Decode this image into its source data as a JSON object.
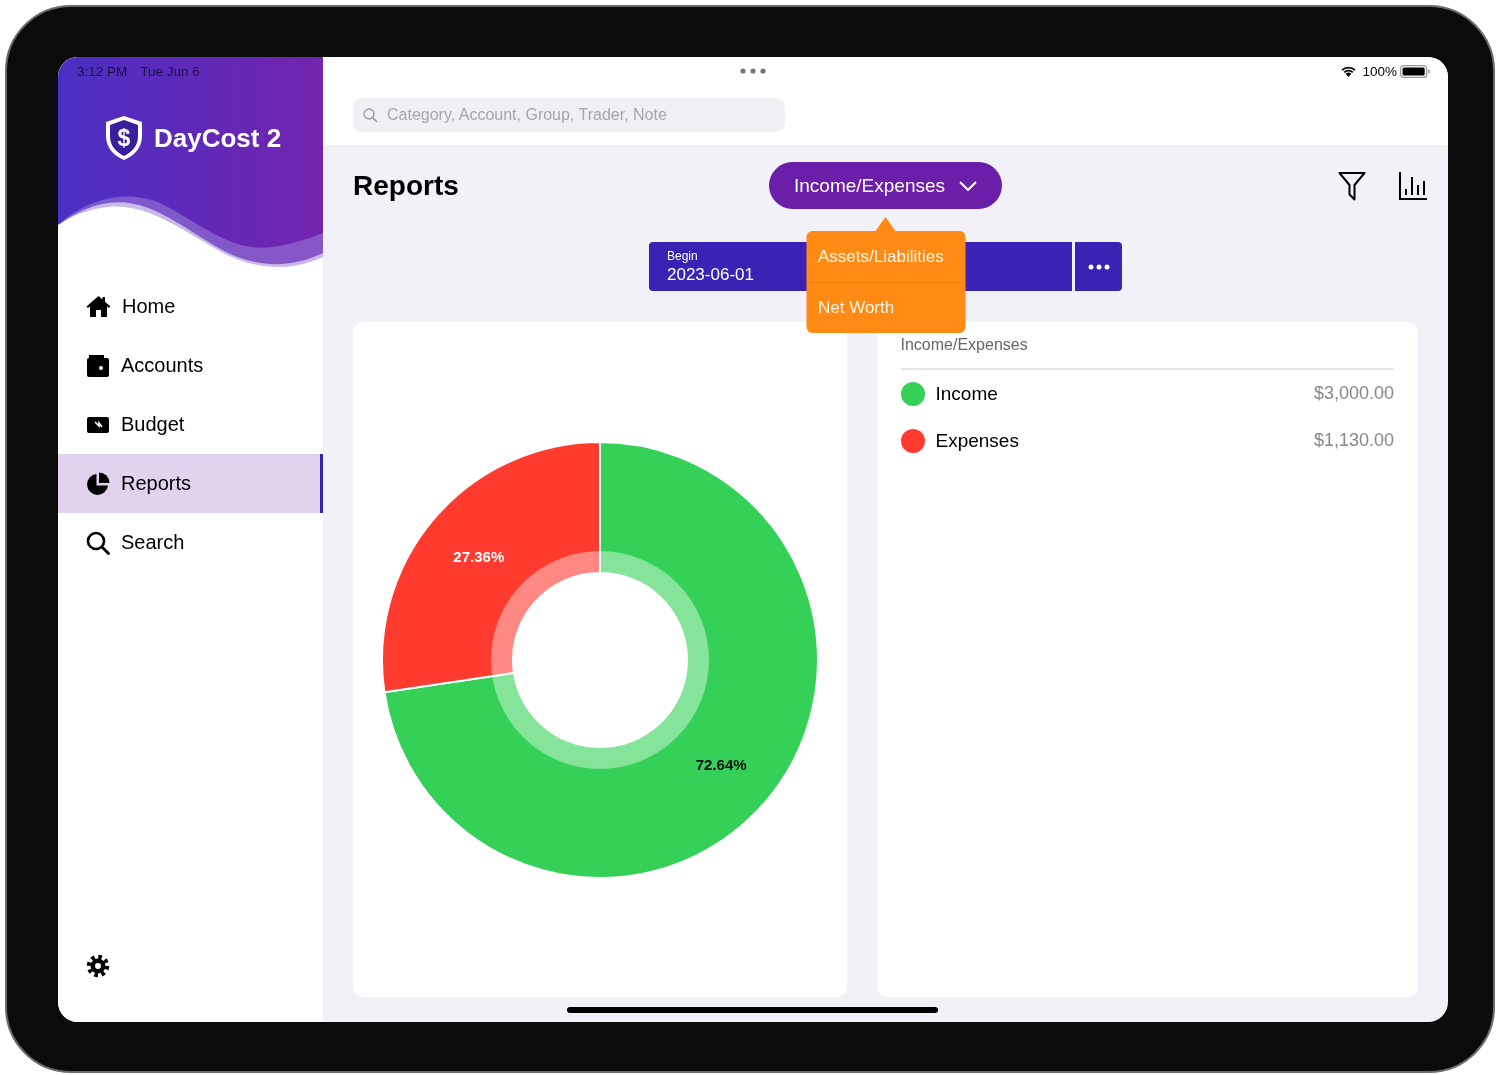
{
  "status_bar": {
    "time": "3:12 PM",
    "date": "Tue Jun 6",
    "battery": "100%"
  },
  "app": {
    "logo_mark": "$",
    "name": "DayCost 2"
  },
  "sidebar": {
    "items": [
      {
        "label": "Home",
        "selected": false
      },
      {
        "label": "Accounts",
        "selected": false
      },
      {
        "label": "Budget",
        "selected": false
      },
      {
        "label": "Reports",
        "selected": true
      },
      {
        "label": "Search",
        "selected": false
      }
    ]
  },
  "search": {
    "placeholder": "Category, Account, Group, Trader, Note"
  },
  "page": {
    "title": "Reports"
  },
  "report_type": {
    "label": "Income/Expenses",
    "expanded": true
  },
  "report_menu": {
    "items": [
      {
        "label": "Assets/Liabilities"
      },
      {
        "label": "Net Worth"
      }
    ]
  },
  "date_range": {
    "begin_label": "Begin",
    "begin": "2023-06-01"
  },
  "chart": {
    "chart_data": {
      "type": "donut",
      "values": [
        72.64,
        27.36
      ],
      "value_labels": [
        "72.64%",
        "27.36%"
      ]
    }
  },
  "legend": {
    "title": "Income/Expenses",
    "items": [
      {
        "name": "Income",
        "amount": "$3,000.00",
        "color": "#34d058"
      },
      {
        "name": "Expenses",
        "amount": "$1,130.00",
        "color": "#ff3b30"
      }
    ]
  }
}
